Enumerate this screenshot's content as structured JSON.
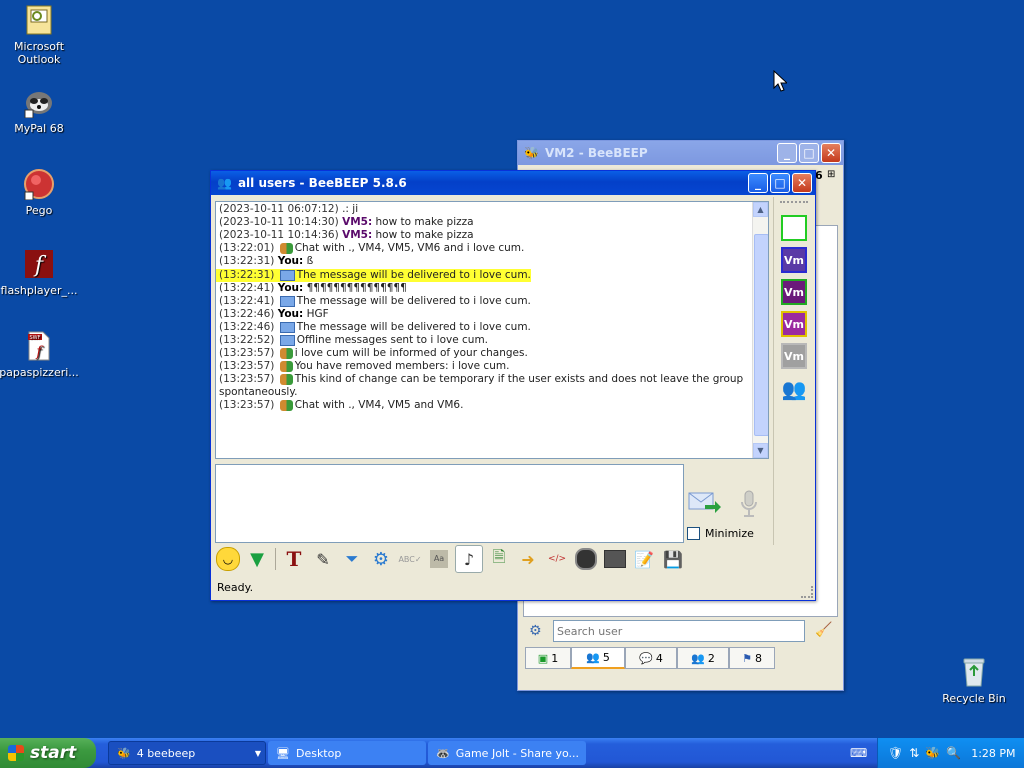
{
  "desktop": {
    "icons": [
      {
        "label": "Microsoft Outlook",
        "icon": "outlook-icon"
      },
      {
        "label": "MyPal 68",
        "icon": "mypal-icon"
      },
      {
        "label": "Pego",
        "icon": "pego-icon"
      },
      {
        "label": "flashplayer_...",
        "icon": "flash-icon"
      },
      {
        "label": "papaspizzeri...",
        "icon": "swf-file-icon"
      },
      {
        "label": "Recycle Bin",
        "icon": "recycle-bin-icon"
      }
    ]
  },
  "back_window": {
    "title": "VM2 - BeeBEEP",
    "search_placeholder": "Search user",
    "partial_text": "6",
    "tabs": [
      {
        "label": "1",
        "icon": "chat-icon"
      },
      {
        "label": "5",
        "icon": "users-icon"
      },
      {
        "label": "4",
        "icon": "messages-icon"
      },
      {
        "label": "2",
        "icon": "groups-icon"
      },
      {
        "label": "8",
        "icon": "log-icon"
      }
    ]
  },
  "chat_window": {
    "title": "all users - BeeBEEP 5.8.6",
    "messages": [
      {
        "ts": "(2023-10-11 06:07:12)",
        "who": "",
        "text": ".: ji",
        "type": "plain"
      },
      {
        "ts": "(2023-10-11 10:14:30)",
        "who": "VM5:",
        "text": "how to make pizza",
        "type": "user"
      },
      {
        "ts": "(2023-10-11 10:14:36)",
        "who": "VM5:",
        "text": "how to make pizza",
        "type": "user"
      },
      {
        "ts": "(13:22:01)",
        "who": "",
        "text": "Chat with ., VM4, VM5, VM6 and i love cum.",
        "type": "group"
      },
      {
        "ts": "(13:22:31)",
        "who": "You:",
        "text": "ß",
        "type": "you"
      },
      {
        "ts": "(13:22:31)",
        "who": "",
        "text": "The message will be delivered to i love cum.",
        "type": "mail-hl"
      },
      {
        "ts": "(13:22:41)",
        "who": "You:",
        "text": "¶¶¶¶¶¶¶¶¶¶¶¶¶¶¶",
        "type": "you"
      },
      {
        "ts": "(13:22:41)",
        "who": "",
        "text": "The message will be delivered to i love cum.",
        "type": "mail"
      },
      {
        "ts": "(13:22:46)",
        "who": "You:",
        "text": "HGF",
        "type": "you"
      },
      {
        "ts": "(13:22:46)",
        "who": "",
        "text": "The message will be delivered to i love cum.",
        "type": "mail"
      },
      {
        "ts": "(13:22:52)",
        "who": "",
        "text": "Offline messages sent to i love cum.",
        "type": "mail"
      },
      {
        "ts": "(13:23:57)",
        "who": "",
        "text": "i love cum will be informed of your changes.",
        "type": "group"
      },
      {
        "ts": "(13:23:57)",
        "who": "",
        "text": "You have removed members: i love cum.",
        "type": "group"
      },
      {
        "ts": "(13:23:57)",
        "who": "",
        "text": "This kind of change can be temporary if the user exists and does not leave the group",
        "type": "group"
      },
      {
        "ts": "",
        "who": "",
        "text": "spontaneously.",
        "type": "plain"
      },
      {
        "ts": "(13:23:57)",
        "who": "",
        "text": "Chat with ., VM4, VM5 and VM6.",
        "type": "group"
      }
    ],
    "minimize_label": "Minimize",
    "status": "Ready.",
    "side_users": [
      {
        "label": "",
        "border": "#22cc22",
        "fill": "#ffffff"
      },
      {
        "label": "Vm",
        "border": "#2b2bd0",
        "fill": "#5a3aa6"
      },
      {
        "label": "Vm",
        "border": "#22aa22",
        "fill": "#6a1a7a"
      },
      {
        "label": "Vm",
        "border": "#e0c000",
        "fill": "#9a2aa0"
      },
      {
        "label": "Vm",
        "border": "#b8b8b8",
        "fill": "#a0a0a0"
      }
    ],
    "toolbar_icons": [
      "emoticon-icon",
      "download-icon",
      "font-icon",
      "color-icon",
      "filter-icon",
      "gear-icon",
      "spellcheck-icon",
      "dictionary-icon",
      "music-note-icon",
      "file-icon",
      "send-file-icon",
      "html-icon",
      "camera-icon",
      "terminal-icon",
      "edit-icon",
      "save-icon"
    ]
  },
  "taskbar": {
    "start_label": "start",
    "tasks": [
      {
        "label": "4 beebeep",
        "icon": "beebeep-icon"
      },
      {
        "label": "Desktop",
        "icon": "desktop-icon"
      },
      {
        "label": "Game Jolt - Share yo...",
        "icon": "browser-icon"
      }
    ],
    "clock": "1:28 PM"
  }
}
